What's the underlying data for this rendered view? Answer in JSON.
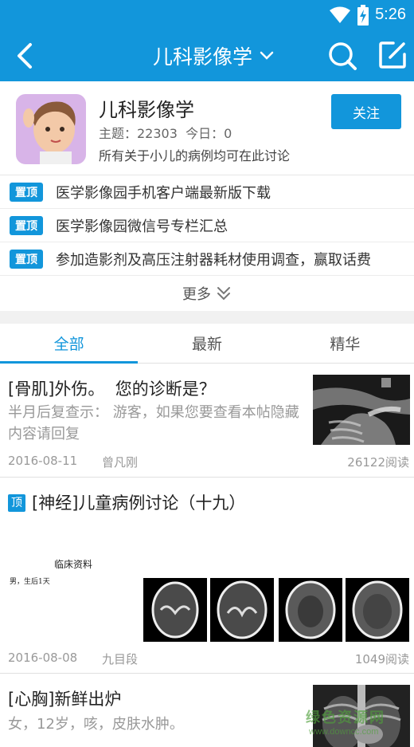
{
  "status_bar": {
    "time": "5:26",
    "icons": [
      "wifi-icon",
      "battery-charging-icon"
    ]
  },
  "app_bar": {
    "title": "儿科影像学",
    "icons": [
      "back-icon",
      "chevron-down-icon",
      "search-icon",
      "edit-icon"
    ]
  },
  "forum": {
    "name": "儿科影像学",
    "stats": "主题：22303  今日：0",
    "description": "所有关于小儿的病例均可在此讨论",
    "follow_label": "关注"
  },
  "pinned": {
    "badge": "置顶",
    "items": [
      {
        "text": "医学影像园手机客户端最新版下载"
      },
      {
        "text": "医学影像园微信号专栏汇总"
      },
      {
        "text": "参加造影剂及高压注射器耗材使用调查，赢取话费"
      }
    ]
  },
  "more_label": "更多",
  "tabs": [
    {
      "label": "全部",
      "active": true
    },
    {
      "label": "最新",
      "active": false
    },
    {
      "label": "精华",
      "active": false
    }
  ],
  "posts": [
    {
      "title": "[骨肌]外伤。  您的诊断是？",
      "excerpt": "半月后复查示：  游客，如果您要查看本帖隐藏内容请回复",
      "date": "2016-08-11",
      "author": "曾凡刚",
      "views": "26122阅读"
    },
    {
      "top_tag": "顶",
      "title": "[神经]儿童病例讨论（十九）",
      "image_caption": "临床资料",
      "image_text": "男，生后1天",
      "date": "2016-08-08",
      "author": "九目段",
      "views": "1049阅读"
    },
    {
      "title": "[心胸]新鲜出炉",
      "excerpt": "女，12岁，咳，皮肤水肿。"
    }
  ],
  "watermark": {
    "line1": "绿色资源网",
    "line2": "www.downcc.com"
  },
  "colors": {
    "primary": "#1296db",
    "muted_text": "#999999",
    "divider": "#e0e0e0"
  }
}
